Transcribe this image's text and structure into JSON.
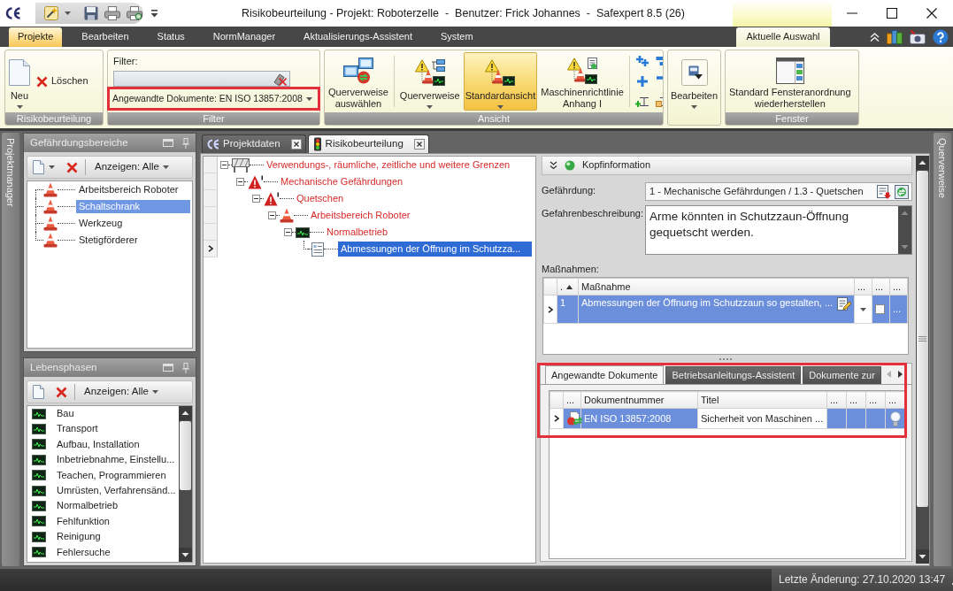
{
  "window": {
    "title": "Risikobeurteilung - Projekt: Roboterzelle  -  Benutzer: Frick Johannes  -  Safexpert 8.5 (26)"
  },
  "ribbon_tabs": [
    {
      "label": "Projekte",
      "selected": true
    },
    {
      "label": "Bearbeiten",
      "selected": false
    },
    {
      "label": "Status",
      "selected": false
    },
    {
      "label": "NormManager",
      "selected": false
    },
    {
      "label": "Aktualisierungs-Assistent",
      "selected": false
    },
    {
      "label": "System",
      "selected": false
    }
  ],
  "context_tabs": [
    {
      "label": "Aktuelle Auswahl",
      "selected": false
    }
  ],
  "ribbon_groups": [
    {
      "kind": "buttons",
      "label": "Risikobeurteilung",
      "buttons": [
        {
          "kind": "large",
          "label": "Neu",
          "dropdown": true
        },
        {
          "kind": "small",
          "label": "Löschen",
          "dropdown": false
        }
      ]
    },
    {
      "kind": "filter",
      "label": "Filter",
      "field_label": "Filter:",
      "filter_value": "Angewandte Dokumente: EN ISO 13857:2008",
      "highlighted": true
    },
    {
      "kind": "buttons",
      "label": "Ansicht",
      "buttons": [
        {
          "kind": "large",
          "label": "Querverweise\nauswählen",
          "dropdown": false
        },
        {
          "kind": "separator"
        },
        {
          "kind": "large",
          "label": "Querverweise",
          "dropdown": true,
          "selected": false
        },
        {
          "kind": "large",
          "label": "Standardansicht",
          "dropdown": true,
          "selected": true
        },
        {
          "kind": "large",
          "label": "Maschinenrichtlinie\nAnhang I",
          "dropdown": false,
          "selected": false
        },
        {
          "kind": "separator"
        },
        {
          "kind": "icon_grid"
        }
      ]
    },
    {
      "kind": "buttons",
      "buttons": [
        {
          "kind": "framed",
          "label": "Bearbeiten",
          "dropdown": true
        }
      ]
    },
    {
      "kind": "buttons",
      "label": "Fenster",
      "buttons": [
        {
          "kind": "large",
          "label": "Standard Fensteranordnung\nwiederherstellen",
          "dropdown": false
        }
      ]
    }
  ],
  "left_sidebar": {
    "label": "Projektmanager"
  },
  "hazard_areas": {
    "title": "Gefährdungsbereiche",
    "new_button_dropdown": true,
    "filter_button": "Anzeigen: Alle",
    "items": [
      {
        "label": "Arbeitsbereich Roboter",
        "selected": false
      },
      {
        "label": "Schaltschrank",
        "selected": true
      },
      {
        "label": "Werkzeug",
        "selected": false
      },
      {
        "label": "Stetigförderer",
        "selected": false
      }
    ]
  },
  "life_phases": {
    "title": "Lebensphasen",
    "new_button_dropdown": false,
    "filter_button": "Anzeigen: Alle",
    "items": [
      {
        "label": "Bau",
        "selected": false
      },
      {
        "label": "Transport",
        "selected": false
      },
      {
        "label": "Aufbau, Installation",
        "selected": false
      },
      {
        "label": "Inbetriebnahme, Einstellu...",
        "selected": false
      },
      {
        "label": "Teachen, Programmieren",
        "selected": false
      },
      {
        "label": "Umrüsten, Verfahrensänd...",
        "selected": false
      },
      {
        "label": "Normalbetrieb",
        "selected": false
      },
      {
        "label": "Fehlfunktion",
        "selected": false
      },
      {
        "label": "Reinigung",
        "selected": false
      },
      {
        "label": "Fehlersuche",
        "selected": false
      }
    ]
  },
  "document_tabs": [
    {
      "label": "Projektdaten",
      "selected": false
    },
    {
      "label": "Risikobeurteilung",
      "selected": true
    }
  ],
  "risk_tree": [
    {
      "kind": "limits",
      "label": "Verwendungs-, räumliche, zeitliche und weitere Grenzen",
      "selected": false,
      "expanded": true,
      "children": [
        {
          "kind": "hazard",
          "label": "Mechanische Gefährdungen",
          "selected": false,
          "expanded": true,
          "children": [
            {
              "kind": "hazard",
              "label": "Quetschen",
              "selected": false,
              "expanded": true,
              "children": [
                {
                  "kind": "area",
                  "label": "Arbeitsbereich Roboter",
                  "selected": false,
                  "expanded": true,
                  "children": [
                    {
                      "kind": "phase",
                      "label": "Normalbetrieb",
                      "selected": false,
                      "expanded": true,
                      "children": [
                        {
                          "kind": "measure",
                          "label": "Abmessungen der Öffnung im Schutzza...",
                          "selected": true
                        }
                      ]
                    }
                  ]
                }
              ]
            }
          ]
        }
      ]
    }
  ],
  "detail": {
    "header": "Kopfinformation",
    "hazard_label": "Gefährdung:",
    "hazard_value": "1 - Mechanische Gefährdungen / 1.3 - Quetschen",
    "description_label": "Gefahrenbeschreibung:",
    "description": "Arme könnten in Schutzzaun-Öffnung gequetscht werden.",
    "measures_label": "Maßnahmen:",
    "measures_columns": [
      {
        "label": ".",
        "sorted": true
      },
      {
        "label": "Maßnahme",
        "sorted": false
      },
      {
        "label": "...",
        "sorted": false
      },
      {
        "label": "...",
        "sorted": false
      },
      {
        "label": "...",
        "sorted": false
      }
    ],
    "measures_rows": [
      {
        "number": "1",
        "text": "Abmessungen der Öffnung im Schutzzaun so gestalten, ...",
        "more": "...",
        "selected": true,
        "checked": false
      }
    ]
  },
  "documents": {
    "highlighted": true,
    "tabs": [
      {
        "label": "Angewandte Dokumente",
        "selected": true
      },
      {
        "label": "Betriebsanleitungs-Assistent",
        "selected": false
      },
      {
        "label": "Dokumente zur",
        "selected": false
      }
    ],
    "columns": [
      {
        "label": "..."
      },
      {
        "label": "Dokumentnummer"
      },
      {
        "label": "Titel"
      },
      {
        "label": "..."
      },
      {
        "label": "..."
      },
      {
        "label": "..."
      },
      {
        "label": "..."
      }
    ],
    "rows": [
      {
        "number": "EN ISO 13857:2008",
        "title": "Sicherheit von Maschinen ...",
        "selected": true
      }
    ]
  },
  "right_sidebar": {
    "label": "Querverweise"
  },
  "status_bar": {
    "text": "Letzte Änderung: 27.10.2020 13:47"
  }
}
